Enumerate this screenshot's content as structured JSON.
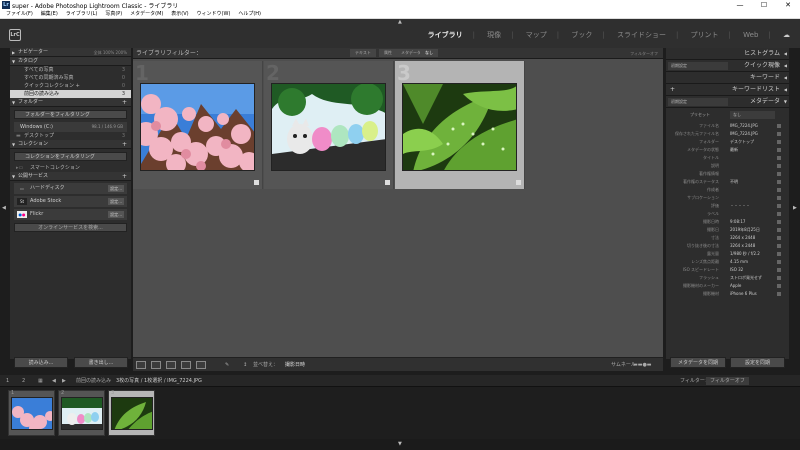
{
  "window": {
    "title": "super - Adobe Photoshop Lightroom Classic - ライブラリ",
    "app_badge": "Lr",
    "min": "—",
    "max": "☐",
    "close": "✕"
  },
  "menu": [
    "ファイル(F)",
    "編集(E)",
    "ライブラリ(L)",
    "写真(P)",
    "メタデータ(M)",
    "表示(V)",
    "ウィンドウ(W)",
    "ヘルプ(H)"
  ],
  "logo": "LrC",
  "modules": {
    "items": [
      "ライブラリ",
      "現像",
      "マップ",
      "ブック",
      "スライドショー",
      "プリント",
      "Web"
    ],
    "active": 0
  },
  "left": {
    "navigator": {
      "label": "ナビゲーター",
      "opts": "全体  100%  200%"
    },
    "catalog": {
      "label": "カタログ",
      "items": [
        {
          "name": "すべての写真",
          "count": "3"
        },
        {
          "name": "すべての同期済み写真",
          "count": "0"
        },
        {
          "name": "クイックコレクション +",
          "count": "0"
        },
        {
          "name": "前回の読み込み",
          "count": "3"
        }
      ]
    },
    "folders": {
      "label": "フォルダー",
      "filter": "フォルダーをフィルタリング",
      "volume": "Windows (C:)",
      "volume_info": "98.1 / 146.9 GB",
      "items": [
        {
          "name": "デスクトップ",
          "count": "3"
        }
      ]
    },
    "collections": {
      "label": "コレクション",
      "filter": "コレクションをフィルタリング",
      "items": [
        {
          "name": "スマートコレクション"
        }
      ]
    },
    "publish": {
      "label": "公開サービス",
      "services": [
        {
          "icon": "hdd",
          "name": "ハードディスク",
          "btn": "設定..."
        },
        {
          "icon": "St",
          "name": "Adobe Stock",
          "btn": "設定..."
        },
        {
          "icon": "flickr",
          "name": "Flickr",
          "btn": "設定..."
        }
      ],
      "find": "オンラインサービスを検索..."
    },
    "import_btn": "読み込み...",
    "export_btn": "書き出し..."
  },
  "filterbar": {
    "label": "ライブラリフィルター：",
    "options": [
      "テキスト",
      "属性",
      "メタデータ",
      "なし"
    ],
    "active": 3,
    "preset": "フィルターオフ"
  },
  "grid": {
    "cells": [
      {
        "index": "1",
        "selected": false,
        "subject": "cherry blossoms"
      },
      {
        "index": "2",
        "selected": false,
        "subject": "balloons and cat figure"
      },
      {
        "index": "3",
        "selected": true,
        "subject": "leaves with water drops"
      }
    ]
  },
  "toolbar": {
    "sort_label": "並べ替え：",
    "sort_value": "撮影日時",
    "thumb_label": "サムネール"
  },
  "right": {
    "histogram": "ヒストグラム",
    "quick_develop": "クイック現像",
    "keywords": "キーワード",
    "keyword_list": "キーワードリスト",
    "metadata": "メタデータ",
    "preset_label": "プリセット",
    "preset_value": "なし",
    "default_label": "初期設定",
    "rows": [
      {
        "k": "ファイル名",
        "v": "IMG_7224.JPG"
      },
      {
        "k": "保存された元ファイル名",
        "v": "IMG_7224.JPG"
      },
      {
        "k": "フォルダー",
        "v": "デスクトップ"
      },
      {
        "k": "メタデータの状態",
        "v": "最新"
      },
      {
        "k": "タイトル",
        "v": ""
      },
      {
        "k": "説明",
        "v": ""
      },
      {
        "k": "著作権情報",
        "v": ""
      },
      {
        "k": "著作権のステータス",
        "v": "不明"
      },
      {
        "k": "作成者",
        "v": ""
      },
      {
        "k": "サブロケーション",
        "v": ""
      },
      {
        "k": "評価",
        "v": "・・・・・"
      },
      {
        "k": "ラベル",
        "v": ""
      },
      {
        "k": "撮影日時",
        "v": "9:08:17"
      },
      {
        "k": "撮影日",
        "v": "2019年8月25日"
      },
      {
        "k": "寸法",
        "v": "3264 x 2448"
      },
      {
        "k": "切り抜き後の寸法",
        "v": "3264 x 2448"
      },
      {
        "k": "露光量",
        "v": "1/980 秒 / f/2.2"
      },
      {
        "k": "レンズ焦点距離",
        "v": "4.15 mm"
      },
      {
        "k": "ISO スピードレート",
        "v": "ISO 32"
      },
      {
        "k": "フラッシュ",
        "v": "ストロボ発光せず"
      },
      {
        "k": "撮影機材のメーカー",
        "v": "Apple"
      },
      {
        "k": "撮影機材",
        "v": "iPhone 6 Plus"
      }
    ],
    "sync_meta_btn": "メタデータを同期",
    "sync_settings_btn": "設定を同期"
  },
  "filmbar": {
    "source": "前回の読み込み",
    "info": "3枚の写真 / 1枚選択 / IMG_7224.JPG",
    "filter_label": "フィルター：",
    "filter_value": "フィルターオフ",
    "page1": "1",
    "page2": "2"
  },
  "filmstrip": [
    {
      "index": "1",
      "selected": false
    },
    {
      "index": "2",
      "selected": false
    },
    {
      "index": "3",
      "selected": true
    }
  ]
}
